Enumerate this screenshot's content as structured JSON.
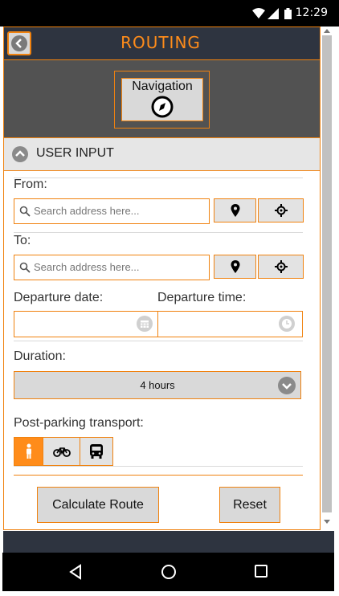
{
  "status": {
    "time": "12:29"
  },
  "header": {
    "title": "ROUTING"
  },
  "navigation": {
    "label": "Navigation"
  },
  "section": {
    "label": "USER INPUT"
  },
  "form": {
    "from_label": "From:",
    "to_label": "To:",
    "search_placeholder": "Search address here...",
    "departure_date_label": "Departure date:",
    "departure_time_label": "Departure time:",
    "duration_label": "Duration:",
    "duration_value": "4 hours",
    "transport_label": "Post-parking transport:",
    "transport_options": [
      "walk",
      "bicycle",
      "bus"
    ],
    "transport_selected": "walk"
  },
  "actions": {
    "calculate": "Calculate Route",
    "reset": "Reset"
  },
  "colors": {
    "accent": "#f0820f",
    "header": "#2e3440",
    "nav_band": "#525252"
  }
}
